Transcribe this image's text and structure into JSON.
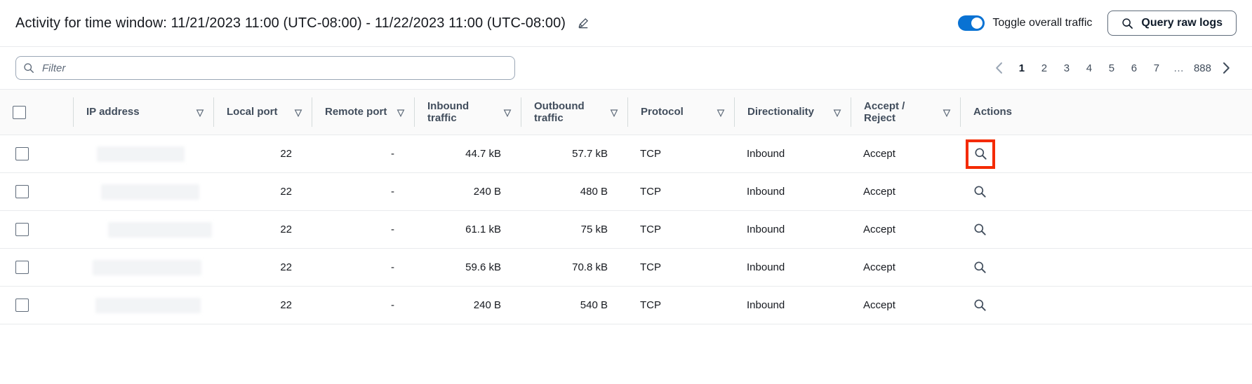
{
  "header": {
    "title": "Activity for time window: 11/21/2023 11:00 (UTC-08:00) - 11/22/2023 11:00 (UTC-08:00)",
    "edit_icon": "pencil-icon",
    "toggle": {
      "label": "Toggle overall traffic",
      "state": "on",
      "accent_color": "#0972d3"
    },
    "query_button": {
      "label": "Query raw logs",
      "icon": "search-icon"
    }
  },
  "filter": {
    "placeholder": "Filter",
    "value": "",
    "icon": "search-icon"
  },
  "pagination": {
    "prev_icon": "chevron-left-icon",
    "next_icon": "chevron-right-icon",
    "pages": [
      "1",
      "2",
      "3",
      "4",
      "5",
      "6",
      "7",
      "…",
      "888"
    ],
    "current": "1"
  },
  "table": {
    "select_all_checkbox": false,
    "columns": [
      {
        "label": "IP address",
        "filterable": true,
        "align": "left"
      },
      {
        "label": "Local port",
        "filterable": true,
        "align": "right"
      },
      {
        "label": "Remote port",
        "filterable": true,
        "align": "right"
      },
      {
        "label": "Inbound traffic",
        "filterable": true,
        "align": "right"
      },
      {
        "label": "Outbound traffic",
        "filterable": true,
        "align": "right"
      },
      {
        "label": "Protocol",
        "filterable": true,
        "align": "left"
      },
      {
        "label": "Directionality",
        "filterable": true,
        "align": "left"
      },
      {
        "label": "Accept / Reject",
        "filterable": true,
        "align": "left"
      },
      {
        "label": "Actions",
        "filterable": false,
        "align": "left"
      }
    ],
    "rows": [
      {
        "selected": false,
        "ip_address": "",
        "ip_redacted": true,
        "local_port": "22",
        "remote_port": "-",
        "inbound_traffic": "44.7 kB",
        "outbound_traffic": "57.7 kB",
        "protocol": "TCP",
        "directionality": "Inbound",
        "accept_reject": "Accept",
        "action_icon": "search-icon",
        "action_highlighted": true
      },
      {
        "selected": false,
        "ip_address": "",
        "ip_redacted": true,
        "local_port": "22",
        "remote_port": "-",
        "inbound_traffic": "240 B",
        "outbound_traffic": "480 B",
        "protocol": "TCP",
        "directionality": "Inbound",
        "accept_reject": "Accept",
        "action_icon": "search-icon",
        "action_highlighted": false
      },
      {
        "selected": false,
        "ip_address": "",
        "ip_redacted": true,
        "local_port": "22",
        "remote_port": "-",
        "inbound_traffic": "61.1 kB",
        "outbound_traffic": "75 kB",
        "protocol": "TCP",
        "directionality": "Inbound",
        "accept_reject": "Accept",
        "action_icon": "search-icon",
        "action_highlighted": false
      },
      {
        "selected": false,
        "ip_address": "",
        "ip_redacted": true,
        "local_port": "22",
        "remote_port": "-",
        "inbound_traffic": "59.6 kB",
        "outbound_traffic": "70.8 kB",
        "protocol": "TCP",
        "directionality": "Inbound",
        "accept_reject": "Accept",
        "action_icon": "search-icon",
        "action_highlighted": false
      },
      {
        "selected": false,
        "ip_address": "",
        "ip_redacted": true,
        "local_port": "22",
        "remote_port": "-",
        "inbound_traffic": "240 B",
        "outbound_traffic": "540 B",
        "protocol": "TCP",
        "directionality": "Inbound",
        "accept_reject": "Accept",
        "action_icon": "search-icon",
        "action_highlighted": false
      }
    ]
  },
  "colors": {
    "accent": "#0972d3",
    "highlight": "#f42a00",
    "header_bg": "#fafafa",
    "border": "#e9ebed"
  }
}
